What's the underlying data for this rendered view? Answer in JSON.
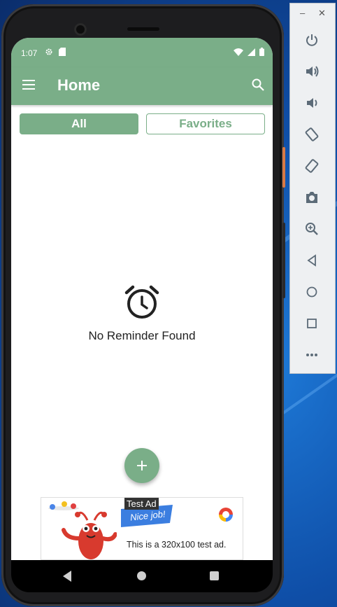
{
  "status_bar": {
    "time": "1:07"
  },
  "app_bar": {
    "title": "Home"
  },
  "tabs": {
    "all": "All",
    "favorites": "Favorites"
  },
  "empty_state": {
    "message": "No Reminder Found"
  },
  "ad": {
    "tag": "Test Ad",
    "banner": "Nice job!",
    "text": "This is a 320x100 test ad."
  },
  "colors": {
    "primary": "#7aae88",
    "ad_banner": "#3b7ee0"
  },
  "emulator_controls": [
    "power-icon",
    "volume-up-icon",
    "volume-down-icon",
    "rotate-left-icon",
    "rotate-right-icon",
    "camera-icon",
    "zoom-icon",
    "back-icon",
    "home-icon",
    "overview-icon",
    "more-icon"
  ]
}
